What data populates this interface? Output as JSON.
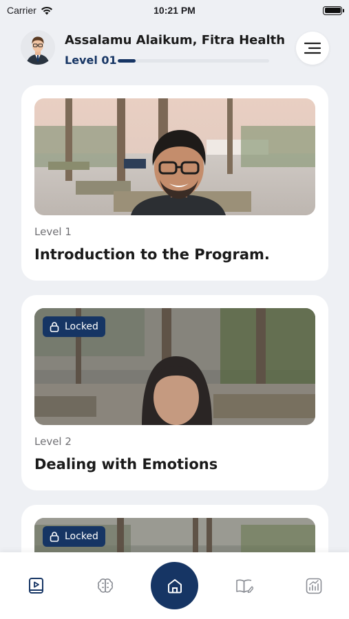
{
  "status_bar": {
    "carrier": "Carrier",
    "time": "10:21 PM"
  },
  "header": {
    "greeting": "Assalamu Alaikum, Fitra Health",
    "level": "Level 01",
    "level_progress": 0.12
  },
  "cards": [
    {
      "level": "Level 1",
      "title": "Introduction to the Program.",
      "locked": false
    },
    {
      "level": "Level 2",
      "title": "Dealing with Emotions",
      "locked": true,
      "badge": "Locked"
    },
    {
      "level": "",
      "title": "",
      "locked": true,
      "badge": "Locked"
    }
  ],
  "bottom_nav": {
    "items": [
      "video-lessons-icon",
      "brain-icon",
      "home-icon",
      "journal-icon",
      "progress-chart-icon"
    ],
    "active": "home-icon"
  },
  "colors": {
    "primary": "#163564",
    "background": "#eef0f4",
    "muted": "#6f6f73"
  }
}
